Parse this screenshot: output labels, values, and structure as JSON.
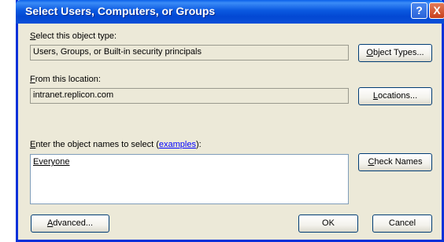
{
  "window": {
    "title": "Select Users, Computers, or Groups"
  },
  "titlebar_buttons": {
    "help": "?",
    "close": "X"
  },
  "object_type": {
    "label_mnemonic": "S",
    "label_rest": "elect this object type:",
    "value": "Users, Groups, or Built-in security principals",
    "button_mnemonic": "O",
    "button_rest": "bject Types..."
  },
  "location": {
    "label_mnemonic": "F",
    "label_rest": "rom this location:",
    "value": "intranet.replicon.com",
    "button_mnemonic": "L",
    "button_rest": "ocations..."
  },
  "names": {
    "label_mnemonic": "E",
    "label_rest": "nter the object names to select (",
    "link": "examples",
    "label_end": "):",
    "value": "Everyone",
    "check_mnemonic": "C",
    "check_rest": "heck Names"
  },
  "footer": {
    "advanced_mnemonic": "A",
    "advanced_rest": "dvanced...",
    "ok": "OK",
    "cancel": "Cancel"
  }
}
